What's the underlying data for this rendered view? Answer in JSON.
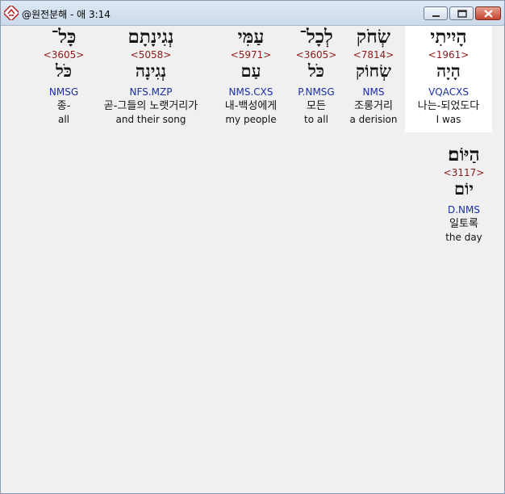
{
  "window": {
    "title": "@원전분해 - 애 3:14"
  },
  "words": [
    {
      "hebrew": "הָיִיתִי",
      "strong": "<1961>",
      "lemma": "הָיָה",
      "morph": "VQACXS",
      "korean": "나는-되었도다",
      "english": "I was",
      "selected": true
    },
    {
      "hebrew": "שְׂחֹק",
      "strong": "<7814>",
      "lemma": "שְׂחוֹק",
      "morph": "NMS",
      "korean": "조롱거리",
      "english": "a derision"
    },
    {
      "hebrew": "לְכָל־",
      "strong": "<3605>",
      "lemma": "כֹּל",
      "morph": "P.NMSG",
      "korean": "모든",
      "english": "to all"
    },
    {
      "hebrew": "עַמִּי",
      "strong": "<5971>",
      "lemma": "עַם",
      "morph": "NMS.CXS",
      "korean": "내-백성에게",
      "english": "my people"
    },
    {
      "hebrew": "נְגִינָתָם",
      "strong": "<5058>",
      "lemma": "נְגִינָה",
      "morph": "NFS.MZP",
      "korean": "곧-그들의 노랫거리가",
      "english": "and their song"
    },
    {
      "hebrew": "כָּל־",
      "strong": "<3605>",
      "lemma": "כֹּל",
      "morph": "NMSG",
      "korean": "종-",
      "english": "all"
    },
    {
      "hebrew": "הַיּוֹם׃",
      "strong": "<3117>",
      "lemma": "יוֹם",
      "morph": "D.NMS",
      "korean": "일토록",
      "english": "the day"
    }
  ]
}
